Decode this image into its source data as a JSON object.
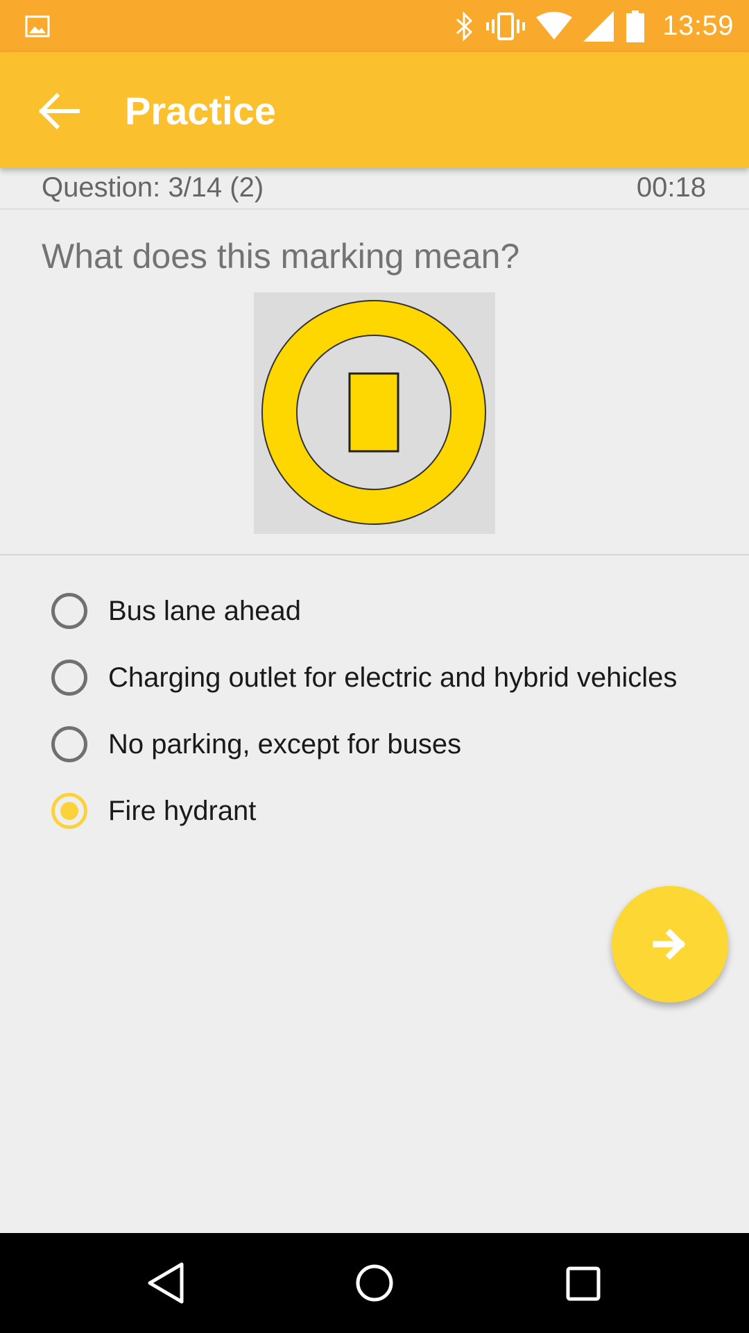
{
  "status_bar": {
    "time": "13:59",
    "icons": [
      "gallery-icon",
      "bluetooth-icon",
      "vibrate-icon",
      "wifi-icon",
      "signal-icon",
      "battery-icon"
    ]
  },
  "app_bar": {
    "title": "Practice",
    "back_icon": "arrow-back-icon"
  },
  "quiz": {
    "question_counter": "Question: 3/14 (2)",
    "timer": "00:18",
    "question": "What does this marking mean?",
    "options": [
      {
        "label": "Bus lane ahead",
        "selected": false
      },
      {
        "label": "Charging outlet for electric and hybrid vehicles",
        "selected": false
      },
      {
        "label": "No parking, except for buses",
        "selected": false
      },
      {
        "label": "Fire hydrant",
        "selected": true
      }
    ]
  },
  "fab": {
    "icon": "arrow-forward-icon"
  },
  "nav_bar": {
    "icons": [
      "back-triangle-icon",
      "home-circle-icon",
      "recents-square-icon"
    ]
  },
  "colors": {
    "status_bar": "#f9a92b",
    "app_bar": "#fbc02d",
    "accent": "#fdd835",
    "sign_yellow": "#ffd700"
  }
}
